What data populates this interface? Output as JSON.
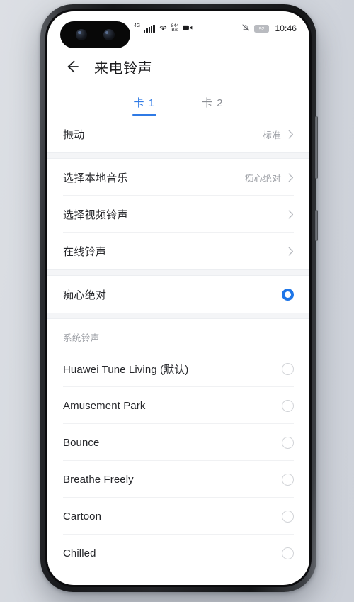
{
  "status_bar": {
    "network_type": "4G",
    "net_speed_value": "844",
    "net_speed_unit": "B/s",
    "video_icon": "video-camera-icon",
    "signal_icon": "signal-bars-icon",
    "wifi_icon": "wifi-icon",
    "mute_icon": "bell-muted-icon",
    "battery_level": "92",
    "time": "10:46"
  },
  "app_bar": {
    "back_icon": "back-arrow-icon",
    "title": "来电铃声"
  },
  "tabs": [
    {
      "label": "卡 1",
      "active": true
    },
    {
      "label": "卡 2",
      "active": false
    }
  ],
  "vibration_group": {
    "label": "振动",
    "value": "标准"
  },
  "source_group": [
    {
      "label": "选择本地音乐",
      "value": "痴心绝对"
    },
    {
      "label": "选择视频铃声",
      "value": ""
    },
    {
      "label": "在线铃声",
      "value": ""
    }
  ],
  "current_selection": {
    "label": "痴心绝对",
    "selected": true
  },
  "system_section": {
    "title": "系统铃声",
    "items": [
      {
        "label": "Huawei Tune Living (默认)",
        "selected": false
      },
      {
        "label": "Amusement Park",
        "selected": false
      },
      {
        "label": "Bounce",
        "selected": false
      },
      {
        "label": "Breathe Freely",
        "selected": false
      },
      {
        "label": "Cartoon",
        "selected": false
      },
      {
        "label": "Chilled",
        "selected": false
      }
    ]
  },
  "colors": {
    "accent": "#2f7ae5",
    "radio_selected": "#1f76e8",
    "text_primary": "#25262a",
    "text_secondary": "#9a9da3",
    "background": "#ffffff"
  }
}
